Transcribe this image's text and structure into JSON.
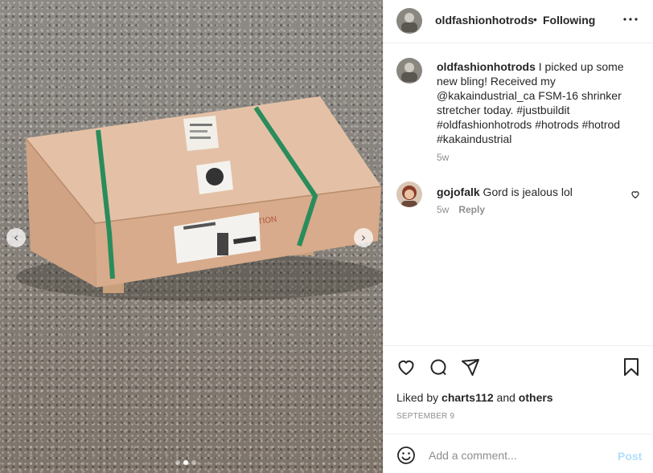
{
  "colors": {
    "text": "#262626",
    "secondary": "#8e8e8e",
    "border": "#efefef",
    "post_disabled": "#b2dffc"
  },
  "photo": {
    "icons": {
      "prev": "chevron-left-icon",
      "next": "chevron-right-icon"
    },
    "carousel": {
      "count": 3,
      "active_index": 1
    }
  },
  "header": {
    "username": "oldfashionhotrods",
    "separator": "•",
    "follow_status": "Following",
    "more_icon": "more-horizontal-icon"
  },
  "caption": {
    "username": "oldfashionhotrods",
    "text": " I picked up some new bling! Received my @kakaindustrial_ca FSM-16 shrinker stretcher today. #justbuildit #oldfashionhotrods #hotrods #hotrod #kakaindustrial",
    "time": "5w"
  },
  "comments": [
    {
      "username": "gojofalk",
      "text": " Gord is jealous lol",
      "time": "5w",
      "reply_label": "Reply"
    }
  ],
  "actions": {
    "icons": [
      "heart-icon",
      "comment-icon",
      "share-icon",
      "bookmark-icon"
    ],
    "liked_by_prefix": "Liked by ",
    "liked_by_user": "charts112",
    "liked_by_and": " and ",
    "liked_by_others": "others",
    "date": "SEPTEMBER 9"
  },
  "comment_box": {
    "placeholder": "Add a comment...",
    "post_label": "Post",
    "emoji_icon": "emoji-icon"
  }
}
